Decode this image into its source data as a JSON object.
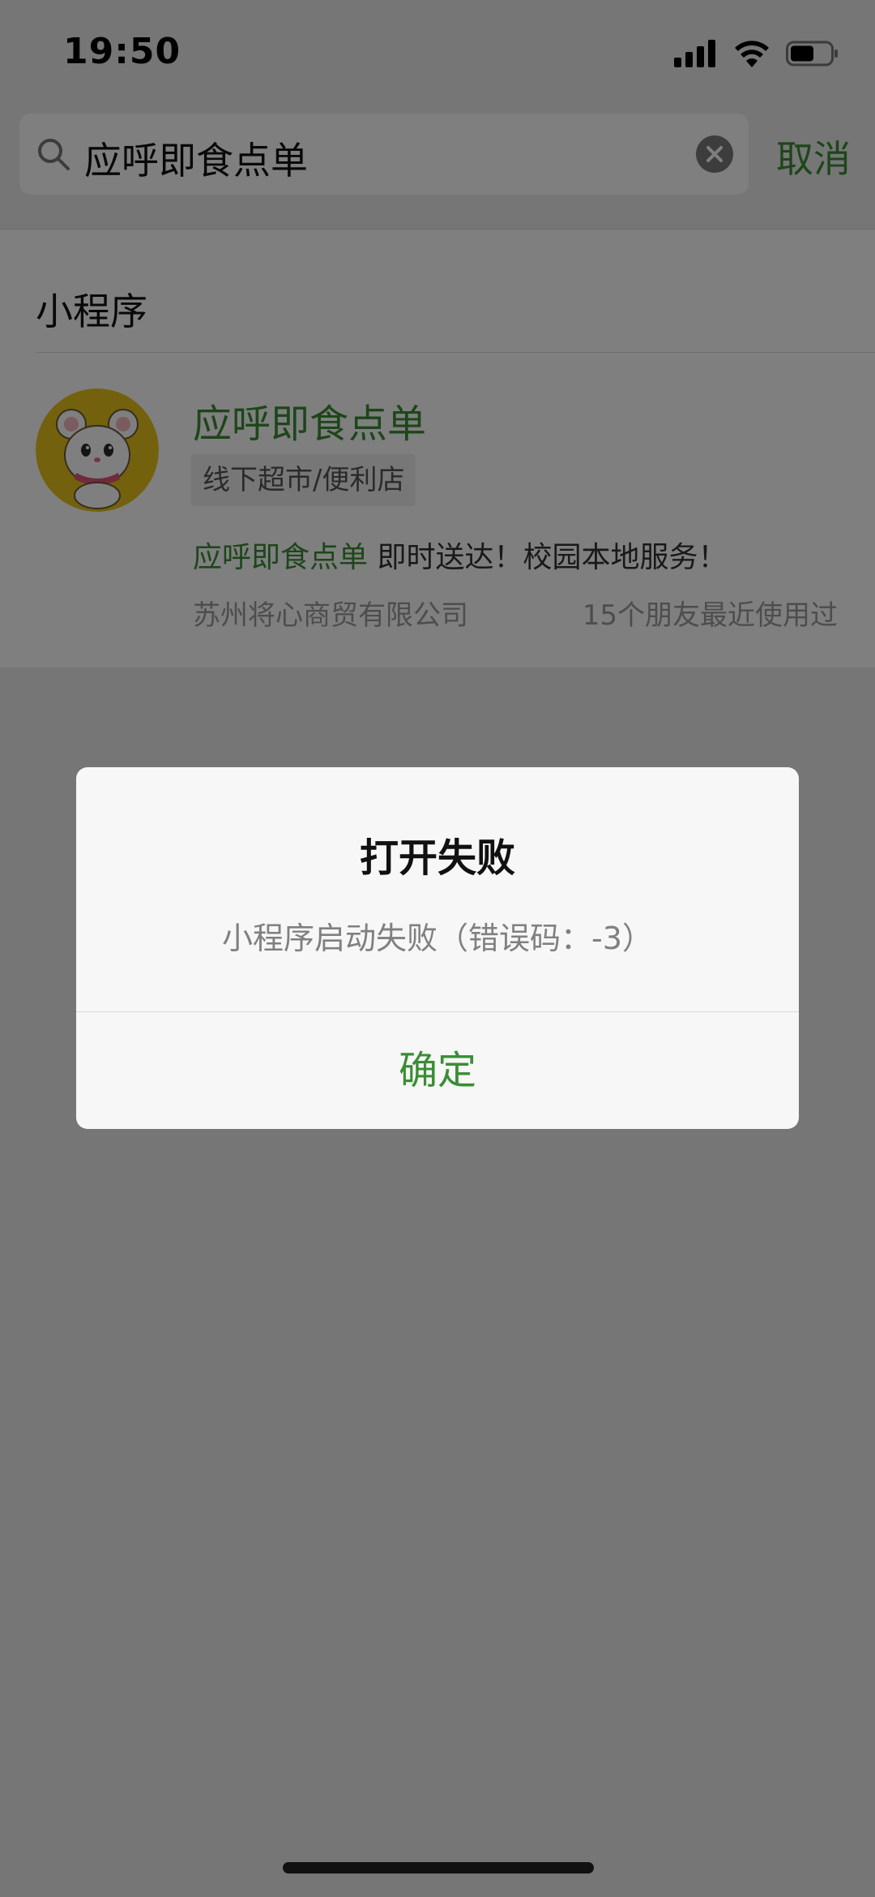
{
  "status_bar": {
    "time": "19:50"
  },
  "search": {
    "query": "应呼即食点单",
    "cancel_label": "取消"
  },
  "results": {
    "section_title": "小程序",
    "item": {
      "name": "应呼即食点单",
      "category": "线下超市/便利店",
      "desc_highlight": "应呼即食点单",
      "desc_rest": " 即时送达！校园本地服务！",
      "company": "苏州将心商贸有限公司",
      "friends_used": "15个朋友最近使用过"
    }
  },
  "dialog": {
    "title": "打开失败",
    "message": "小程序启动失败（错误码：-3）",
    "confirm_label": "确定"
  },
  "colors": {
    "accent": "#3a8d35",
    "overlay": "rgba(0,0,0,0.5)",
    "avatar_bg": "#e7c21a"
  }
}
